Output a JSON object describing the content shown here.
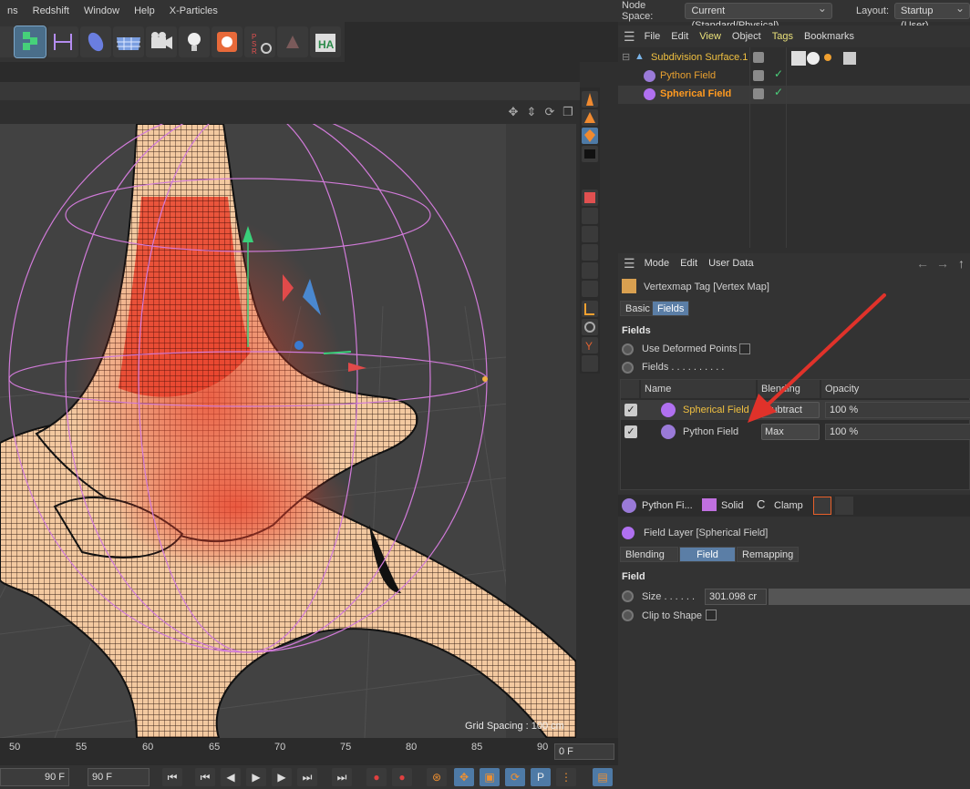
{
  "menubar": {
    "items": [
      "ns",
      "Redshift",
      "Window",
      "Help",
      "X-Particles"
    ]
  },
  "header": {
    "node_space_label": "Node Space:",
    "node_space_value": "Current (Standard/Physical)",
    "layout_label": "Layout:",
    "layout_value": "Startup (User)"
  },
  "object_manager": {
    "menu": [
      "File",
      "Edit",
      "View",
      "Object",
      "Tags",
      "Bookmarks"
    ],
    "objects": [
      {
        "name": "Subdivision Surface.1",
        "color": "#f0c040"
      },
      {
        "name": "Python Field",
        "color": "#e8a030"
      },
      {
        "name": "Spherical Field",
        "color": "#ff9a20"
      }
    ]
  },
  "attribute_manager": {
    "menu": [
      "Mode",
      "Edit",
      "User Data"
    ],
    "title": "Vertexmap Tag [Vertex Map]",
    "tabs": [
      "Basic",
      "Fields"
    ],
    "active_tab": "Fields",
    "section_fields": "Fields",
    "use_deformed_points": "Use Deformed Points",
    "fields_label": "Fields . . . . . . . . . .",
    "table": {
      "headers": [
        "Name",
        "Blending",
        "Opacity"
      ],
      "rows": [
        {
          "name": "Spherical Field",
          "blending": "Subtract",
          "opacity": "100 %"
        },
        {
          "name": "Python Field",
          "blending": "Max",
          "opacity": "100 %"
        }
      ]
    },
    "layer_buttons": [
      "Python Fi...",
      "Solid",
      "Clamp"
    ],
    "layer_title": "Field Layer [Spherical Field]",
    "layer_tabs": [
      "Blending",
      "Field",
      "Remapping"
    ],
    "layer_active_tab": "Field",
    "section_field": "Field",
    "size_label": "Size . . . . . .",
    "size_value": "301.098 cr",
    "clip_label": "Clip to Shape"
  },
  "viewport": {
    "grid_spacing": "Grid Spacing : 100 cm"
  },
  "timeline": {
    "ticks": [
      "50",
      "55",
      "60",
      "65",
      "70",
      "75",
      "80",
      "85",
      "90"
    ],
    "current_frame": "0 F",
    "end_frame_a": "90 F",
    "end_frame_b": "90 F"
  },
  "colors": {
    "accent": "#5b7ea6",
    "highlight_orange": "#ff9a20",
    "arrow_red": "#e0322a"
  }
}
